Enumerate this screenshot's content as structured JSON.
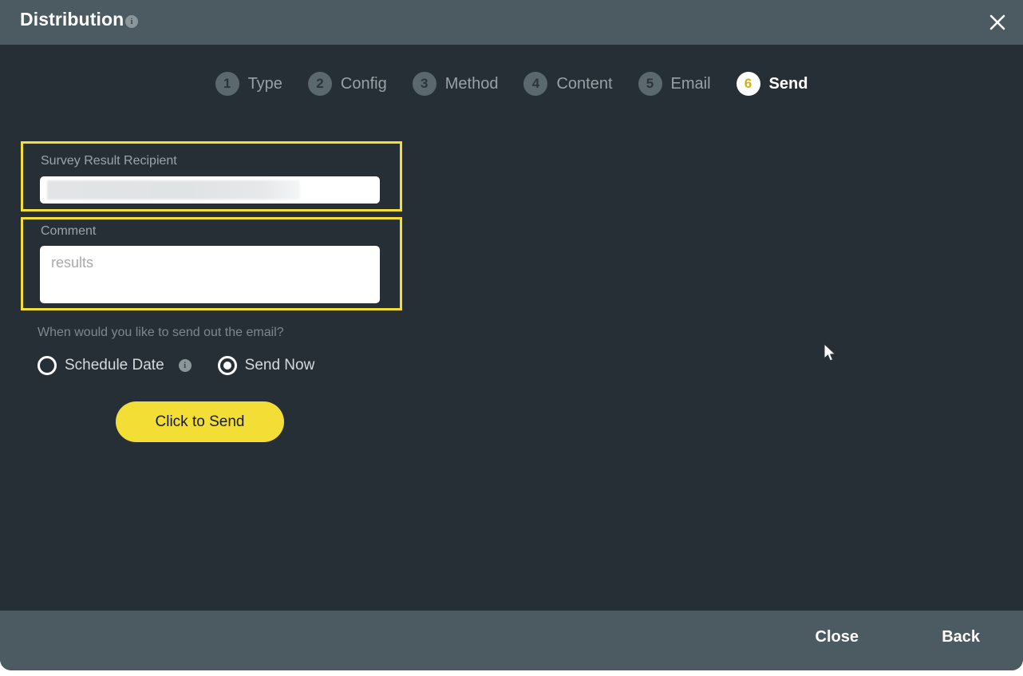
{
  "dialog": {
    "title": "Distribution",
    "title_info_icon": "info-icon",
    "close_icon": "close-icon"
  },
  "stepper": {
    "steps": [
      {
        "number": "1",
        "label": "Type",
        "active": false
      },
      {
        "number": "2",
        "label": "Config",
        "active": false
      },
      {
        "number": "3",
        "label": "Method",
        "active": false
      },
      {
        "number": "4",
        "label": "Content",
        "active": false
      },
      {
        "number": "5",
        "label": "Email",
        "active": false
      },
      {
        "number": "6",
        "label": "Send",
        "active": true
      }
    ]
  },
  "form": {
    "recipient": {
      "label": "Survey Result Recipient",
      "value": "",
      "placeholder": "",
      "redacted": true
    },
    "comment": {
      "label": "Comment",
      "value": "",
      "placeholder": "results"
    },
    "schedule_prompt": "When would you like to send out the email?",
    "radios": [
      {
        "label": "Schedule Date",
        "selected": false,
        "info_icon": "info-icon"
      },
      {
        "label": "Send Now",
        "selected": true
      }
    ],
    "send_button_label": "Click to Send"
  },
  "footer": {
    "close_label": "Close",
    "back_label": "Back"
  },
  "colors": {
    "header_bg": "#4c5a61",
    "body_bg": "#262f35",
    "accent_yellow": "#f2de35",
    "active_step_number": "#d4af0b",
    "muted_text": "#97a1a6"
  }
}
